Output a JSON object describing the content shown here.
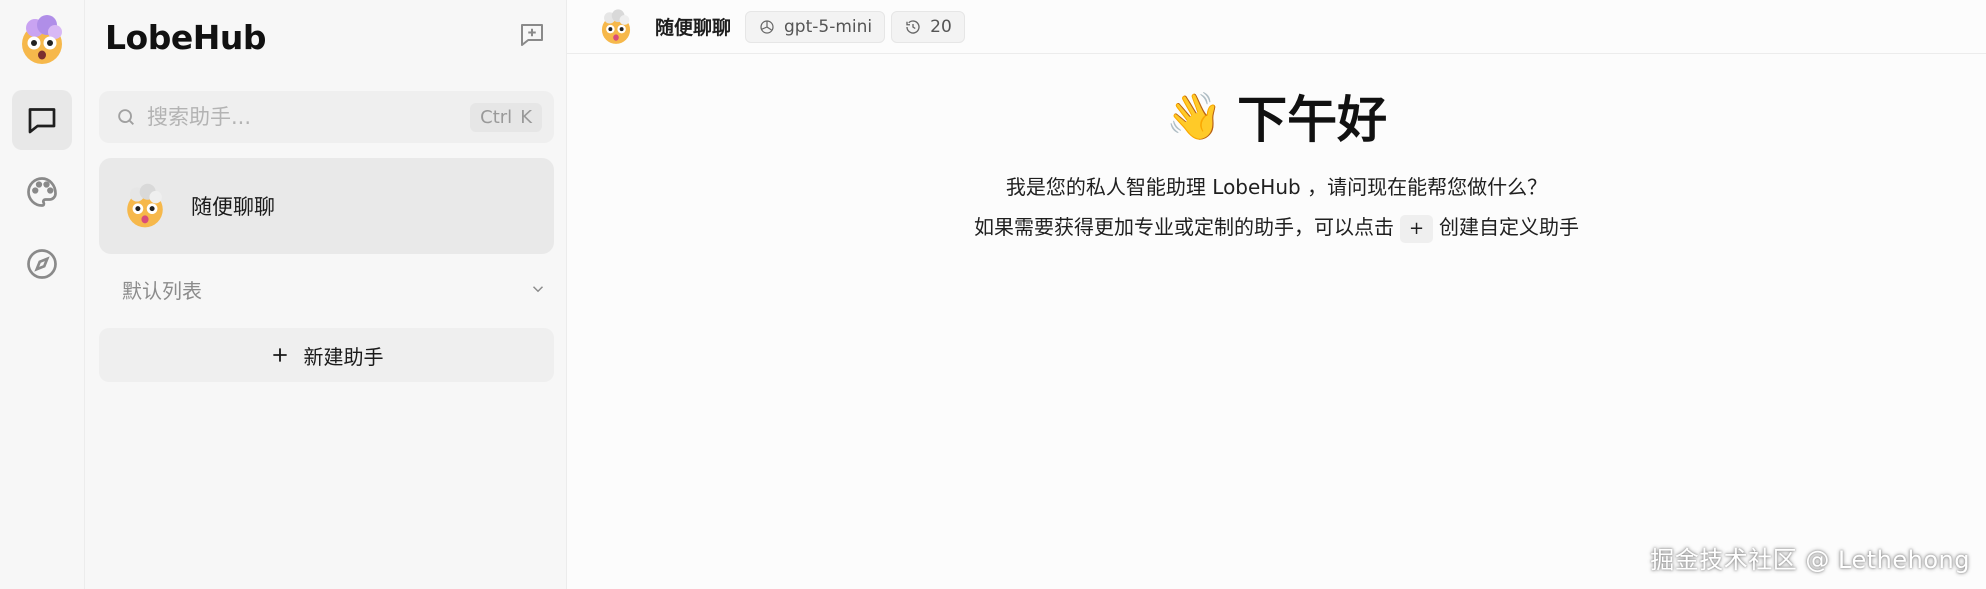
{
  "rail": {
    "avatar_emoji": "🤯",
    "items": [
      {
        "name": "chat",
        "icon": "message-square-icon",
        "active": true
      },
      {
        "name": "palette",
        "icon": "palette-icon",
        "active": false
      },
      {
        "name": "discover",
        "icon": "compass-icon",
        "active": false
      }
    ]
  },
  "sidebar": {
    "brand": "LobeHub",
    "search": {
      "placeholder": "搜索助手...",
      "shortcut_mod": "Ctrl",
      "shortcut_key": "K"
    },
    "sessions": [
      {
        "title": "随便聊聊",
        "avatar_emoji": "🤯"
      }
    ],
    "group_label": "默认列表",
    "new_agent_label": "新建助手"
  },
  "header": {
    "title": "随便聊聊",
    "avatar_emoji": "🤯",
    "model": "gpt-5-mini",
    "history_count": "20"
  },
  "main": {
    "wave_emoji": "👋",
    "greeting": "下午好",
    "line1": "我是您的私人智能助理 LobeHub ，请问现在能帮您做什么？",
    "line2_before": "如果需要获得更加专业或定制的助手，可以点击",
    "plus": "+",
    "line2_after": "创建自定义助手"
  },
  "watermark": "掘金技术社区 @ Lethehong",
  "colors": {
    "accent": "#1f1f1f",
    "panel_bg": "#f7f7f7",
    "active_bg": "#e8e8e8"
  }
}
